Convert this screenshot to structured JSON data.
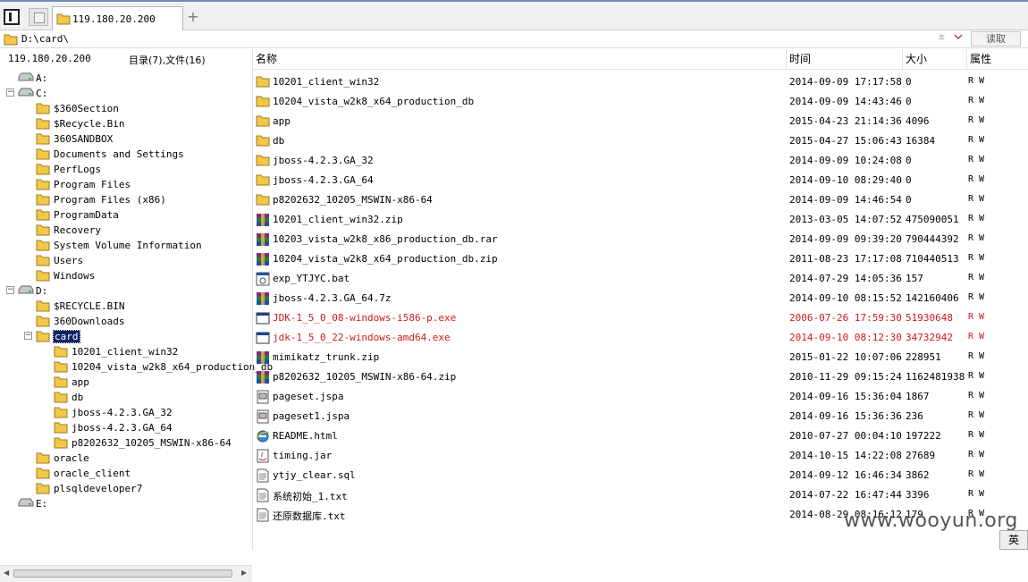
{
  "tab": {
    "label": "119.180.20.200",
    "add_label": "+"
  },
  "pathbar": {
    "path": "D:\\card\\",
    "plus_symbol": "±",
    "read_label": "读取"
  },
  "left": {
    "host": "119.180.20.200",
    "summary": "目录(7),文件(16)",
    "tree": [
      {
        "name": "A:",
        "type": "drive",
        "level": 0,
        "expander": ""
      },
      {
        "name": "C:",
        "type": "drive",
        "level": 0,
        "expander": "−"
      },
      {
        "name": "$360Section",
        "type": "folder",
        "level": 1
      },
      {
        "name": "$Recycle.Bin",
        "type": "folder",
        "level": 1
      },
      {
        "name": "360SANDBOX",
        "type": "folder",
        "level": 1
      },
      {
        "name": "Documents and Settings",
        "type": "folder",
        "level": 1
      },
      {
        "name": "PerfLogs",
        "type": "folder",
        "level": 1
      },
      {
        "name": "Program Files",
        "type": "folder",
        "level": 1
      },
      {
        "name": "Program Files (x86)",
        "type": "folder",
        "level": 1
      },
      {
        "name": "ProgramData",
        "type": "folder",
        "level": 1
      },
      {
        "name": "Recovery",
        "type": "folder",
        "level": 1
      },
      {
        "name": "System Volume Information",
        "type": "folder",
        "level": 1
      },
      {
        "name": "Users",
        "type": "folder",
        "level": 1
      },
      {
        "name": "Windows",
        "type": "folder",
        "level": 1
      },
      {
        "name": "D:",
        "type": "drive",
        "level": 0,
        "expander": "−"
      },
      {
        "name": "$RECYCLE.BIN",
        "type": "folder",
        "level": 1
      },
      {
        "name": "360Downloads",
        "type": "folder",
        "level": 1
      },
      {
        "name": "card",
        "type": "folder",
        "level": 1,
        "expander": "−",
        "selected": true
      },
      {
        "name": "10201_client_win32",
        "type": "folder",
        "level": 2
      },
      {
        "name": "10204_vista_w2k8_x64_production_db",
        "type": "folder",
        "level": 2
      },
      {
        "name": "app",
        "type": "folder",
        "level": 2
      },
      {
        "name": "db",
        "type": "folder",
        "level": 2
      },
      {
        "name": "jboss-4.2.3.GA_32",
        "type": "folder",
        "level": 2
      },
      {
        "name": "jboss-4.2.3.GA_64",
        "type": "folder",
        "level": 2
      },
      {
        "name": "p8202632_10205_MSWIN-x86-64",
        "type": "folder",
        "level": 2
      },
      {
        "name": "oracle",
        "type": "folder",
        "level": 1
      },
      {
        "name": "oracle_client",
        "type": "folder",
        "level": 1
      },
      {
        "name": "plsqldeveloper7",
        "type": "folder",
        "level": 1
      },
      {
        "name": "E:",
        "type": "drive",
        "level": 0,
        "expander": ""
      }
    ]
  },
  "columns": {
    "name": "名称",
    "time": "时间",
    "size": "大小",
    "attr": "属性"
  },
  "files": [
    {
      "name": "10201_client_win32",
      "time": "2014-09-09 17:17:58",
      "size": "0",
      "attr": "R W",
      "icon": "folder-icon"
    },
    {
      "name": "10204_vista_w2k8_x64_production_db",
      "time": "2014-09-09 14:43:46",
      "size": "0",
      "attr": "R W",
      "icon": "folder-icon"
    },
    {
      "name": "app",
      "time": "2015-04-23 21:14:36",
      "size": "4096",
      "attr": "R W",
      "icon": "folder-icon"
    },
    {
      "name": "db",
      "time": "2015-04-27 15:06:43",
      "size": "16384",
      "attr": "R W",
      "icon": "folder-icon"
    },
    {
      "name": "jboss-4.2.3.GA_32",
      "time": "2014-09-09 10:24:08",
      "size": "0",
      "attr": "R W",
      "icon": "folder-icon"
    },
    {
      "name": "jboss-4.2.3.GA_64",
      "time": "2014-09-10 08:29:40",
      "size": "0",
      "attr": "R W",
      "icon": "folder-icon"
    },
    {
      "name": "p8202632_10205_MSWIN-x86-64",
      "time": "2014-09-09 14:46:54",
      "size": "0",
      "attr": "R W",
      "icon": "folder-icon"
    },
    {
      "name": "10201_client_win32.zip",
      "time": "2013-03-05 14:07:52",
      "size": "475090051",
      "attr": "R W",
      "icon": "archive-icon"
    },
    {
      "name": "10203_vista_w2k8_x86_production_db.rar",
      "time": "2014-09-09 09:39:20",
      "size": "790444392",
      "attr": "R W",
      "icon": "archive-icon"
    },
    {
      "name": "10204_vista_w2k8_x64_production_db.zip",
      "time": "2011-08-23 17:17:08",
      "size": "710440513",
      "attr": "R W",
      "icon": "archive-icon"
    },
    {
      "name": "exp_YTJYC.bat",
      "time": "2014-07-29 14:05:36",
      "size": "157",
      "attr": "R W",
      "icon": "batch-file-icon"
    },
    {
      "name": "jboss-4.2.3.GA_64.7z",
      "time": "2014-09-10 08:15:52",
      "size": "142160406",
      "attr": "R W",
      "icon": "archive-icon"
    },
    {
      "name": "JDK-1_5_0_08-windows-i586-p.exe",
      "time": "2006-07-26 17:59:30",
      "size": "51930648",
      "attr": "R W",
      "icon": "exe-window-icon",
      "highlight": true
    },
    {
      "name": "jdk-1_5_0_22-windows-amd64.exe",
      "time": "2014-09-10 08:12:30",
      "size": "34732942",
      "attr": "R W",
      "icon": "exe-window-icon",
      "highlight": true
    },
    {
      "name": "mimikatz_trunk.zip",
      "time": "2015-01-22 10:07:06",
      "size": "228951",
      "attr": "R W",
      "icon": "archive-icon"
    },
    {
      "name": "p8202632_10205_MSWIN-x86-64.zip",
      "time": "2010-11-29 09:15:24",
      "size": "1162481938",
      "attr": "R W",
      "icon": "archive-icon"
    },
    {
      "name": "pageset.jspa",
      "time": "2014-09-16 15:36:04",
      "size": "1867",
      "attr": "R W",
      "icon": "generic-file-icon"
    },
    {
      "name": "pageset1.jspa",
      "time": "2014-09-16 15:36:36",
      "size": "236",
      "attr": "R W",
      "icon": "generic-file-icon"
    },
    {
      "name": "README.html",
      "time": "2010-07-27 00:04:10",
      "size": "197222",
      "attr": "R W",
      "icon": "ie-html-icon"
    },
    {
      "name": "timing.jar",
      "time": "2014-10-15 14:22:08",
      "size": "27689",
      "attr": "R W",
      "icon": "jar-file-icon"
    },
    {
      "name": "ytjy_clear.sql",
      "time": "2014-09-12 16:46:34",
      "size": "3862",
      "attr": "R W",
      "icon": "text-file-icon"
    },
    {
      "name": "系统初始_1.txt",
      "time": "2014-07-22 16:47:44",
      "size": "3396",
      "attr": "R W",
      "icon": "text-file-icon"
    },
    {
      "name": "还原数据库.txt",
      "time": "2014-08-29 08:16:12",
      "size": "179",
      "attr": "R W",
      "icon": "text-file-icon"
    }
  ],
  "colors": {
    "highlight": "#d21a1a",
    "folder": "#f2c84b",
    "selection": "#0a246a"
  },
  "watermark": "www.wooyun.org",
  "ime": "英"
}
